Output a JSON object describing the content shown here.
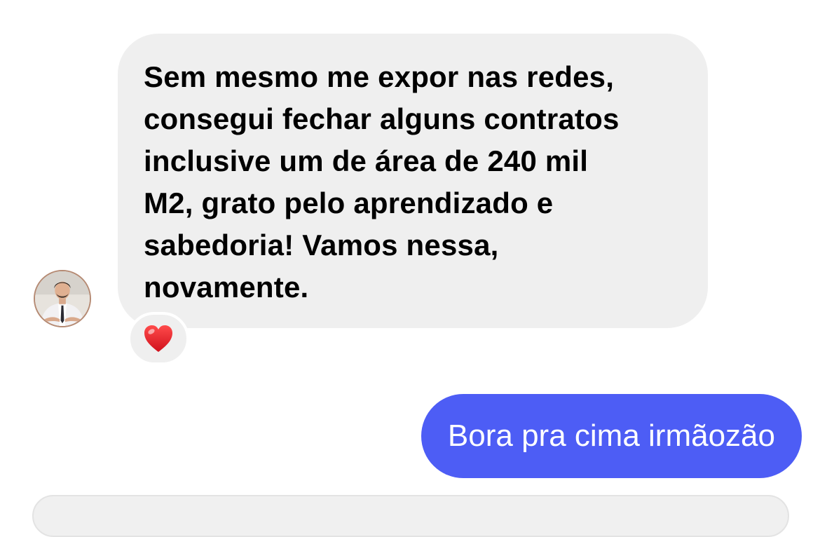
{
  "conversation": {
    "incoming": {
      "lines": [
        "Sem mesmo me expor nas redes,",
        "consegui fechar alguns contratos",
        "inclusive um de área de 240 mil",
        "M2, grato pelo aprendizado e",
        "sabedoria! Vamos nessa,",
        "novamente."
      ],
      "reaction": "heart-emoji",
      "avatar": "contact-avatar"
    },
    "outgoing": {
      "text": "Bora pra cima irmãozão"
    }
  },
  "colors": {
    "incoming_bubble": "#efefef",
    "outgoing_bubble": "#4d5df5",
    "text_dark": "#000000",
    "text_light": "#ffffff",
    "heart": "#e8202a"
  }
}
